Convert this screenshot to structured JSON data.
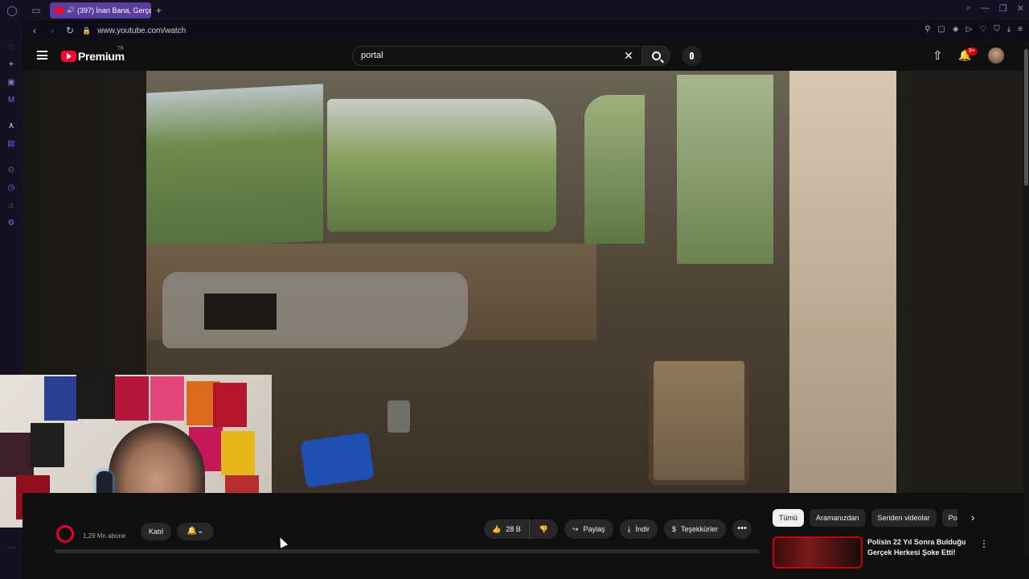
{
  "browser": {
    "tab_title": "(397) İnan Bana, Gerçe",
    "url": "www.youtube.com/watch"
  },
  "youtube": {
    "logo_text": "Premium",
    "region": "TR",
    "search_query": "portal",
    "notif_count": "9+"
  },
  "channel": {
    "subscribers": "1,29 Mn abone",
    "join_label": "Katıl"
  },
  "actions": {
    "likes": "28 B",
    "share": "Paylaş",
    "download": "İndir",
    "thanks": "Teşekkürler",
    "more": "•••"
  },
  "chips": [
    "Tümü",
    "Aramanızdan",
    "Seriden videolar",
    "Po"
  ],
  "recommendation": {
    "title": "Polisin 22 Yıl Sonra Bulduğu Gerçek Herkesi Şoke Etti!"
  },
  "colors": {
    "accent": "#5b3da0",
    "youtube_red": "#ff0033",
    "background": "#0f0f0f"
  }
}
